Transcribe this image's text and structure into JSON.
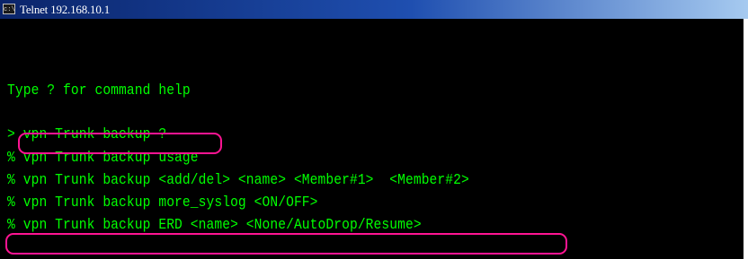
{
  "window": {
    "title": "Telnet 192.168.10.1",
    "title_icon": "c:\\"
  },
  "terminal": {
    "lines": [
      "Type ? for command help",
      "> vpn Trunk backup ?",
      "% vpn Trunk backup usage",
      "% vpn Trunk backup <add/del> <name> <Member#1>  <Member#2>",
      "% vpn Trunk backup more_syslog <ON/OFF>",
      "% vpn Trunk backup ERD <name> <None/AutoDrop/Resume>"
    ],
    "text_color": "#00ff00",
    "background_color": "#000000",
    "highlight_color": "#ff1493"
  }
}
